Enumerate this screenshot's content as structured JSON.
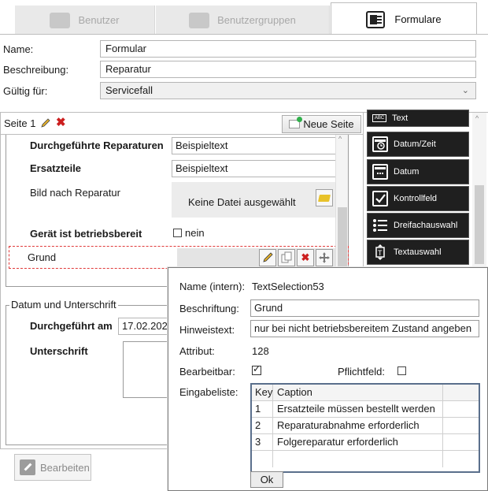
{
  "tabs": [
    {
      "label": "Benutzer",
      "active": false
    },
    {
      "label": "Benutzergruppen",
      "active": false
    },
    {
      "label": "Formulare",
      "active": true
    }
  ],
  "form_props": {
    "name_label": "Name:",
    "name_value": "Formular",
    "desc_label": "Beschreibung:",
    "desc_value": "Reparatur",
    "valid_label": "Gültig für:",
    "valid_value": "Servicefall"
  },
  "page": {
    "title": "Seite 1",
    "new_page_label": "Neue Seite"
  },
  "fields": {
    "repairs_label": "Durchgeführte Reparaturen",
    "repairs_value": "Beispieltext",
    "parts_label": "Ersatzteile",
    "parts_value": "Beispieltext",
    "image_label": "Bild nach Reparatur",
    "image_value": "Keine Datei ausgewählt",
    "ready_label": "Gerät ist betriebsbereit",
    "ready_value": "nein",
    "reason_label": "Grund"
  },
  "group": {
    "legend": "Datum und Unterschrift",
    "done_label": "Durchgeführt am",
    "done_value": "17.02.202",
    "signature_label": "Unterschrift"
  },
  "edit_button": "Bearbeiten",
  "palette": [
    {
      "label": "Text",
      "icon": "abc-icon"
    },
    {
      "label": "Datum/Zeit",
      "icon": "calendar-clock-icon"
    },
    {
      "label": "Datum",
      "icon": "calendar-icon"
    },
    {
      "label": "Kontrollfeld",
      "icon": "checkbox-icon"
    },
    {
      "label": "Dreifachauswahl",
      "icon": "list-icon"
    },
    {
      "label": "Textauswahl",
      "icon": "text-select-icon"
    }
  ],
  "popup": {
    "internal_name_label": "Name (intern):",
    "internal_name_value": "TextSelection53",
    "caption_label": "Beschriftung:",
    "caption_value": "Grund",
    "hint_label": "Hinweistext:",
    "hint_value": "nur bei nicht betriebsbereitem Zustand angeben",
    "attr_label": "Attribut:",
    "attr_value": "128",
    "editable_label": "Bearbeitbar:",
    "required_label": "Pflichtfeld:",
    "list_label": "Eingabeliste:",
    "list_headers": [
      "Key",
      "Caption"
    ],
    "list_rows": [
      {
        "key": "1",
        "caption": "Ersatzteile müssen bestellt werden"
      },
      {
        "key": "2",
        "caption": "Reparaturabnahme erforderlich"
      },
      {
        "key": "3",
        "caption": "Folgereparatur erforderlich"
      }
    ],
    "ok_label": "Ok"
  },
  "colors": {
    "palette_bg": "#1f1f1f",
    "delete_red": "#cc1f1f",
    "selection_border": "#e03a3a"
  }
}
